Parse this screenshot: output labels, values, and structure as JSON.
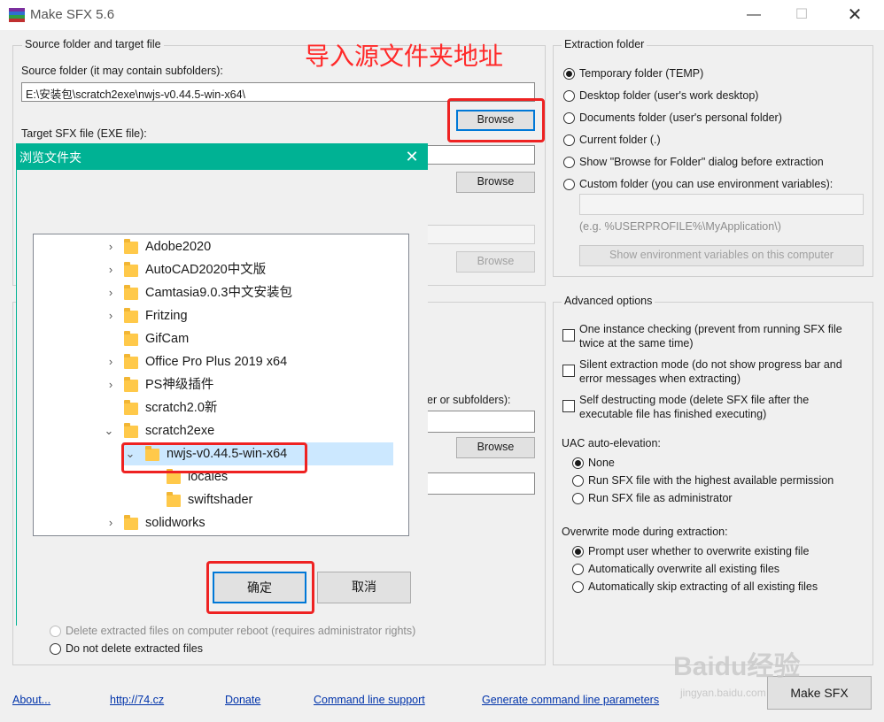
{
  "app": {
    "title": "Make SFX 5.6"
  },
  "annotation": {
    "text": "导入源文件夹地址"
  },
  "source_group": {
    "label": "Source folder and target file",
    "source_label": "Source folder (it may contain subfolders):",
    "source_value": "E:\\安装包\\scratch2exe\\nwjs-v0.44.5-win-x64\\",
    "browse_label": "Browse",
    "target_label": "Target SFX file (EXE file):",
    "partial_label": "er or subfolders):"
  },
  "extraction": {
    "label": "Extraction folder",
    "options": [
      {
        "label": "Temporary folder (TEMP)",
        "selected": true
      },
      {
        "label": "Desktop folder (user's work desktop)",
        "selected": false
      },
      {
        "label": "Documents folder (user's personal folder)",
        "selected": false
      },
      {
        "label": "Current folder (.)",
        "selected": false
      },
      {
        "label": "Show \"Browse for Folder\" dialog before extraction",
        "selected": false
      },
      {
        "label": "Custom folder (you can use environment variables):",
        "selected": false
      }
    ],
    "custom_hint": "(e.g. %USERPROFILE%\\MyApplication\\)",
    "env_button": "Show environment variables on this computer"
  },
  "advanced": {
    "label": "Advanced options",
    "checks": [
      {
        "line1": "One instance checking (prevent from running SFX file",
        "line2": "twice at the same time)"
      },
      {
        "line1": "Silent extraction mode (do not show progress bar and",
        "line2": "error messages when extracting)"
      },
      {
        "line1": "Self destructing mode (delete SFX file after the",
        "line2": "executable file has finished executing)"
      }
    ],
    "uac_label": "UAC auto-elevation:",
    "uac_options": [
      {
        "label": "None",
        "selected": true
      },
      {
        "label": "Run SFX file with the highest available permission",
        "selected": false
      },
      {
        "label": "Run SFX file as administrator",
        "selected": false
      }
    ],
    "overwrite_label": "Overwrite mode during extraction:",
    "overwrite_options": [
      {
        "label": "Prompt user whether to overwrite existing file",
        "selected": true
      },
      {
        "label": "Automatically overwrite all existing files",
        "selected": false
      },
      {
        "label": "Automatically skip extracting of all existing files",
        "selected": false
      }
    ]
  },
  "delete_options": [
    {
      "label": "Delete extracted files on computer reboot (requires administrator rights)",
      "selected": false,
      "disabled": true
    },
    {
      "label": "Do not delete extracted files",
      "selected": false,
      "disabled": false
    }
  ],
  "footer": {
    "links": [
      "About...",
      "http://74.cz",
      "Donate",
      "Command line support",
      "Generate command line parameters"
    ],
    "make_button": "Make SFX"
  },
  "dialog": {
    "title": "浏览文件夹",
    "tree": [
      {
        "label": "Adobe2020",
        "expander": "collapsed"
      },
      {
        "label": "AutoCAD2020中文版",
        "expander": "collapsed"
      },
      {
        "label": "Camtasia9.0.3中文安装包",
        "expander": "collapsed"
      },
      {
        "label": "Fritzing",
        "expander": "collapsed"
      },
      {
        "label": "GifCam",
        "expander": "none"
      },
      {
        "label": "Office Pro Plus 2019  x64",
        "expander": "collapsed"
      },
      {
        "label": "PS神级插件",
        "expander": "collapsed"
      },
      {
        "label": "scratch2.0新",
        "expander": "none"
      },
      {
        "label": "scratch2exe",
        "expander": "expanded"
      },
      {
        "label": "nwjs-v0.44.5-win-x64",
        "expander": "expanded",
        "selected": true
      },
      {
        "label": "locales",
        "expander": "none"
      },
      {
        "label": "swiftshader",
        "expander": "none"
      },
      {
        "label": "solidworks",
        "expander": "collapsed"
      }
    ],
    "ok_label": "确定",
    "cancel_label": "取消"
  },
  "watermark": {
    "brand": "Baidu经验",
    "url": "jingyan.baidu.com"
  },
  "colors": {
    "dialog_title": "#00b294",
    "highlight": "#ee2222",
    "selection": "#cce8ff",
    "focus": "#0078d7"
  }
}
